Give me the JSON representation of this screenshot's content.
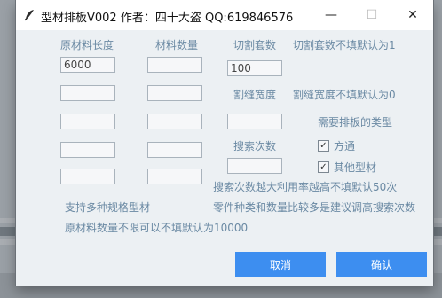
{
  "window": {
    "title": "型材排板V002   作者：四十大盗 QQ:619846576",
    "minimize_glyph": "—",
    "maximize_glyph": "☐",
    "close_glyph": "✕"
  },
  "labels": {
    "raw_length": "原材料长度",
    "raw_qty": "材料数量",
    "cut_sets": "切割套数",
    "cut_sets_hint": "切割套数不填默认为1",
    "kerf": "割缝宽度",
    "kerf_hint": "割缝宽度不填默认为0",
    "layout_type": "需要排板的类型",
    "search_count": "搜索次数",
    "search_hint": "搜索次数越大利用率越高不填默认50次",
    "multi_spec": "支持多种规格型材",
    "parts_hint": "零件种类和数量比较多是建议调高搜索次数",
    "raw_qty_hint": "原材料数量不限可以不填默认为10000"
  },
  "inputs": {
    "raw_length_1": "6000",
    "cut_sets": "100"
  },
  "checkboxes": {
    "square_tube": {
      "label": "方通",
      "checked": true
    },
    "other_profile": {
      "label": "其他型材",
      "checked": true
    }
  },
  "buttons": {
    "cancel": "取消",
    "confirm": "确认"
  },
  "colors": {
    "accent": "#3d8ef0",
    "label": "#6a89a3",
    "panel": "#ecf0f3"
  },
  "icons": {
    "app": "feather-pen-icon"
  }
}
